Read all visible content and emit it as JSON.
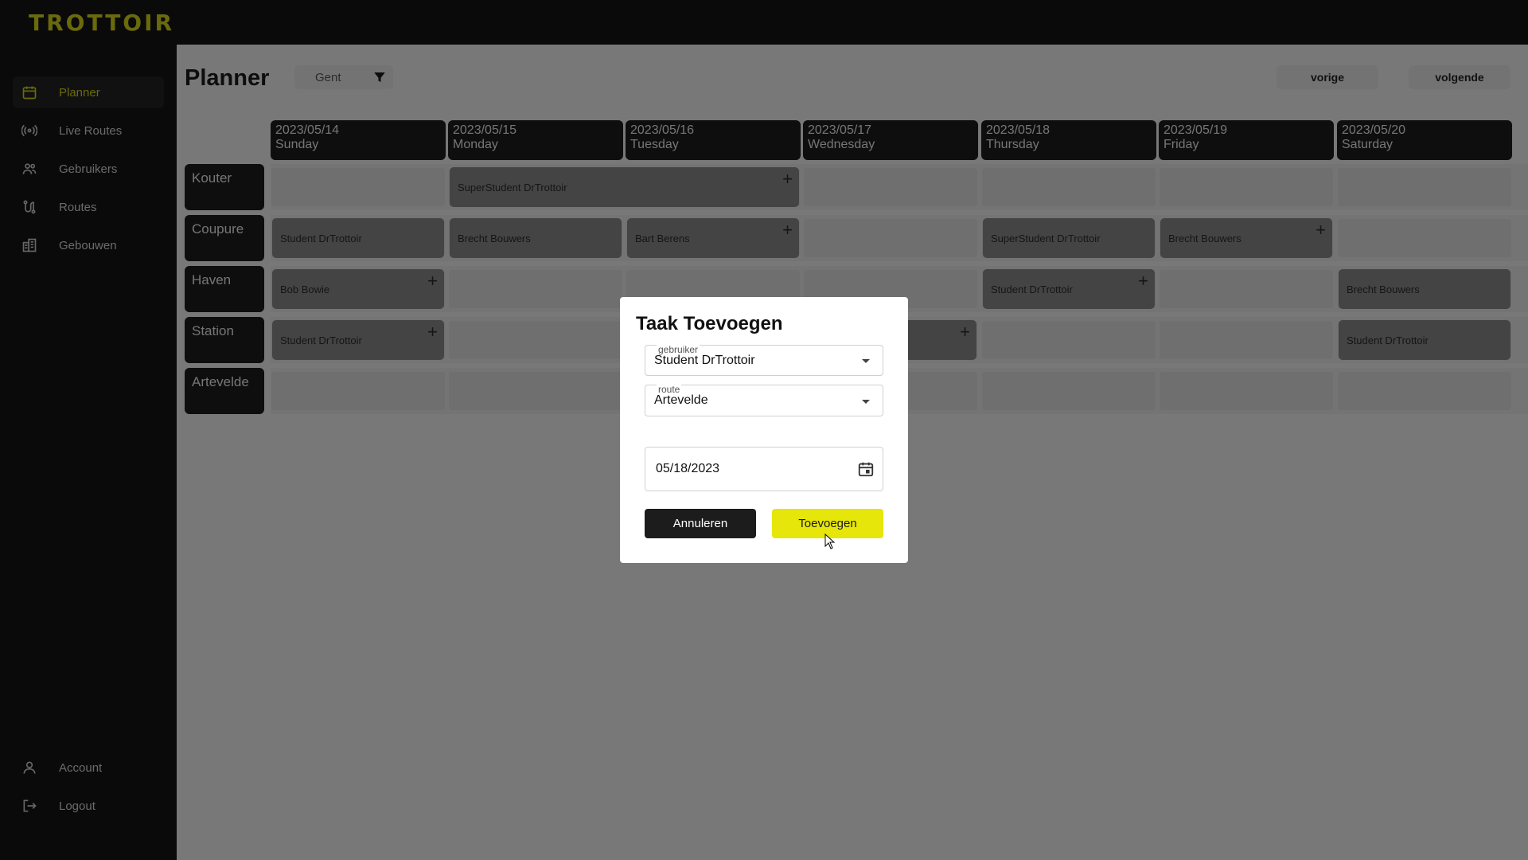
{
  "app": {
    "logo": "TROTTOIR"
  },
  "sidebar": {
    "items": [
      {
        "label": "Planner",
        "icon": "calendar-icon",
        "active": true
      },
      {
        "label": "Live Routes",
        "icon": "broadcast-icon"
      },
      {
        "label": "Gebruikers",
        "icon": "users-icon"
      },
      {
        "label": "Routes",
        "icon": "route-icon"
      },
      {
        "label": "Gebouwen",
        "icon": "buildings-icon"
      }
    ],
    "bottom": [
      {
        "label": "Account",
        "icon": "person-icon"
      },
      {
        "label": "Logout",
        "icon": "logout-icon"
      }
    ]
  },
  "main": {
    "title": "Planner",
    "region": "Gent",
    "prev_label": "vorige",
    "next_label": "volgende",
    "days": [
      {
        "date": "2023/05/14",
        "day": "Sunday"
      },
      {
        "date": "2023/05/15",
        "day": "Monday"
      },
      {
        "date": "2023/05/16",
        "day": "Tuesday"
      },
      {
        "date": "2023/05/17",
        "day": "Wednesday"
      },
      {
        "date": "2023/05/18",
        "day": "Thursday"
      },
      {
        "date": "2023/05/19",
        "day": "Friday"
      },
      {
        "date": "2023/05/20",
        "day": "Saturday"
      }
    ],
    "routes": [
      "Kouter",
      "Coupure",
      "Haven",
      "Station",
      "Artevelde"
    ],
    "tasks": [
      {
        "route": 0,
        "start": 1,
        "span": 2,
        "label": "SuperStudent DrTrottoir",
        "plus": true
      },
      {
        "route": 1,
        "start": 0,
        "span": 1,
        "label": "Student DrTrottoir",
        "plus": false
      },
      {
        "route": 1,
        "start": 1,
        "span": 1,
        "label": "Brecht Bouwers",
        "plus": false
      },
      {
        "route": 1,
        "start": 2,
        "span": 1,
        "label": "Bart Berens",
        "plus": true
      },
      {
        "route": 1,
        "start": 4,
        "span": 1,
        "label": "SuperStudent DrTrottoir",
        "plus": false
      },
      {
        "route": 1,
        "start": 5,
        "span": 1,
        "label": "Brecht Bouwers",
        "plus": true
      },
      {
        "route": 2,
        "start": 0,
        "span": 1,
        "label": "Bob Bowie",
        "plus": true
      },
      {
        "route": 2,
        "start": 4,
        "span": 1,
        "label": "Student DrTrottoir",
        "plus": true
      },
      {
        "route": 2,
        "start": 6,
        "span": 1,
        "label": "Brecht Bouwers",
        "plus": false
      },
      {
        "route": 3,
        "start": 0,
        "span": 1,
        "label": "Student DrTrottoir",
        "plus": true
      },
      {
        "route": 3,
        "start": 3,
        "span": 1,
        "label": "",
        "plus": true
      },
      {
        "route": 3,
        "start": 6,
        "span": 1,
        "label": "Student DrTrottoir",
        "plus": false
      }
    ]
  },
  "dialog": {
    "title": "Taak Toevoegen",
    "user_label": "gebruiker",
    "user_value": "Student DrTrottoir",
    "route_label": "route",
    "route_value": "Artevelde",
    "date_value": "05/18/2023",
    "cancel_label": "Annuleren",
    "add_label": "Toevoegen"
  },
  "colors": {
    "accent": "#e6e60a",
    "sidebar": "#141414",
    "task": "#888888"
  }
}
